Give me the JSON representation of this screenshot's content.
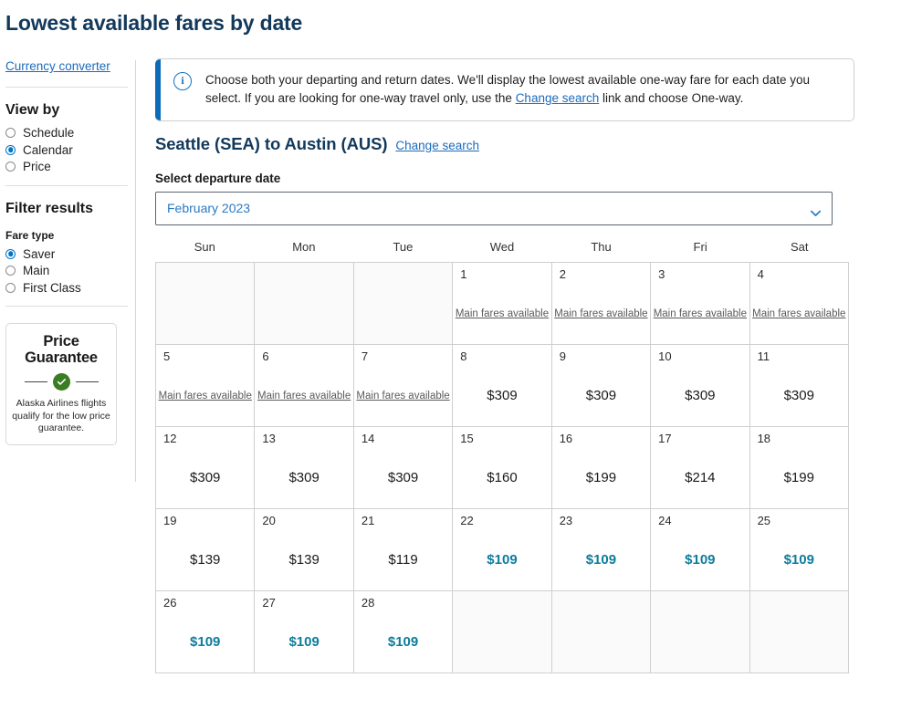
{
  "page_title": "Lowest available fares by date",
  "sidebar": {
    "currency_link": "Currency converter",
    "view_by": {
      "heading": "View by",
      "options": [
        {
          "label": "Schedule",
          "selected": false
        },
        {
          "label": "Calendar",
          "selected": true
        },
        {
          "label": "Price",
          "selected": false
        }
      ]
    },
    "filter_results": {
      "heading": "Filter results",
      "fare_type_label": "Fare type",
      "options": [
        {
          "label": "Saver",
          "selected": true
        },
        {
          "label": "Main",
          "selected": false
        },
        {
          "label": "First Class",
          "selected": false
        }
      ]
    },
    "price_guarantee": {
      "title_line1": "Price",
      "title_line2": "Guarantee",
      "text": "Alaska Airlines flights qualify for the low price guarantee."
    }
  },
  "banner": {
    "icon": "info-icon",
    "text_part1": "Choose both your departing and return dates. We'll display the lowest available one-way fare for each date you select. If you are looking for one-way travel only, use the ",
    "link": "Change search",
    "text_part2": " link and choose One-way."
  },
  "route": {
    "title": "Seattle (SEA) to Austin (AUS)",
    "change_search": "Change search"
  },
  "departure": {
    "label": "Select departure date",
    "selected_month": "February 2023"
  },
  "calendar": {
    "weekday_headers": [
      "Sun",
      "Mon",
      "Tue",
      "Wed",
      "Thu",
      "Fri",
      "Sat"
    ],
    "main_fares_label": "Main fares available",
    "cells": [
      {
        "day": null,
        "type": "empty"
      },
      {
        "day": null,
        "type": "empty"
      },
      {
        "day": null,
        "type": "empty"
      },
      {
        "day": "1",
        "type": "mainfare"
      },
      {
        "day": "2",
        "type": "mainfare"
      },
      {
        "day": "3",
        "type": "mainfare"
      },
      {
        "day": "4",
        "type": "mainfare"
      },
      {
        "day": "5",
        "type": "mainfare"
      },
      {
        "day": "6",
        "type": "mainfare"
      },
      {
        "day": "7",
        "type": "mainfare"
      },
      {
        "day": "8",
        "type": "price",
        "price": "$309",
        "sale": false
      },
      {
        "day": "9",
        "type": "price",
        "price": "$309",
        "sale": false
      },
      {
        "day": "10",
        "type": "price",
        "price": "$309",
        "sale": false
      },
      {
        "day": "11",
        "type": "price",
        "price": "$309",
        "sale": false
      },
      {
        "day": "12",
        "type": "price",
        "price": "$309",
        "sale": false
      },
      {
        "day": "13",
        "type": "price",
        "price": "$309",
        "sale": false
      },
      {
        "day": "14",
        "type": "price",
        "price": "$309",
        "sale": false
      },
      {
        "day": "15",
        "type": "price",
        "price": "$160",
        "sale": false
      },
      {
        "day": "16",
        "type": "price",
        "price": "$199",
        "sale": false
      },
      {
        "day": "17",
        "type": "price",
        "price": "$214",
        "sale": false
      },
      {
        "day": "18",
        "type": "price",
        "price": "$199",
        "sale": false
      },
      {
        "day": "19",
        "type": "price",
        "price": "$139",
        "sale": false
      },
      {
        "day": "20",
        "type": "price",
        "price": "$139",
        "sale": false
      },
      {
        "day": "21",
        "type": "price",
        "price": "$119",
        "sale": false
      },
      {
        "day": "22",
        "type": "price",
        "price": "$109",
        "sale": true
      },
      {
        "day": "23",
        "type": "price",
        "price": "$109",
        "sale": true
      },
      {
        "day": "24",
        "type": "price",
        "price": "$109",
        "sale": true
      },
      {
        "day": "25",
        "type": "price",
        "price": "$109",
        "sale": true
      },
      {
        "day": "26",
        "type": "price",
        "price": "$109",
        "sale": true
      },
      {
        "day": "27",
        "type": "price",
        "price": "$109",
        "sale": true
      },
      {
        "day": "28",
        "type": "price",
        "price": "$109",
        "sale": true
      },
      {
        "day": null,
        "type": "empty"
      },
      {
        "day": null,
        "type": "empty"
      },
      {
        "day": null,
        "type": "empty"
      },
      {
        "day": null,
        "type": "empty"
      }
    ]
  },
  "colors": {
    "heading_navy": "#12395b",
    "link_blue": "#1b6bbd",
    "radio_blue": "#0074c8",
    "banner_bar": "#0c6bb8",
    "sale_teal": "#0e7c9b",
    "check_green": "#3a7d22"
  }
}
